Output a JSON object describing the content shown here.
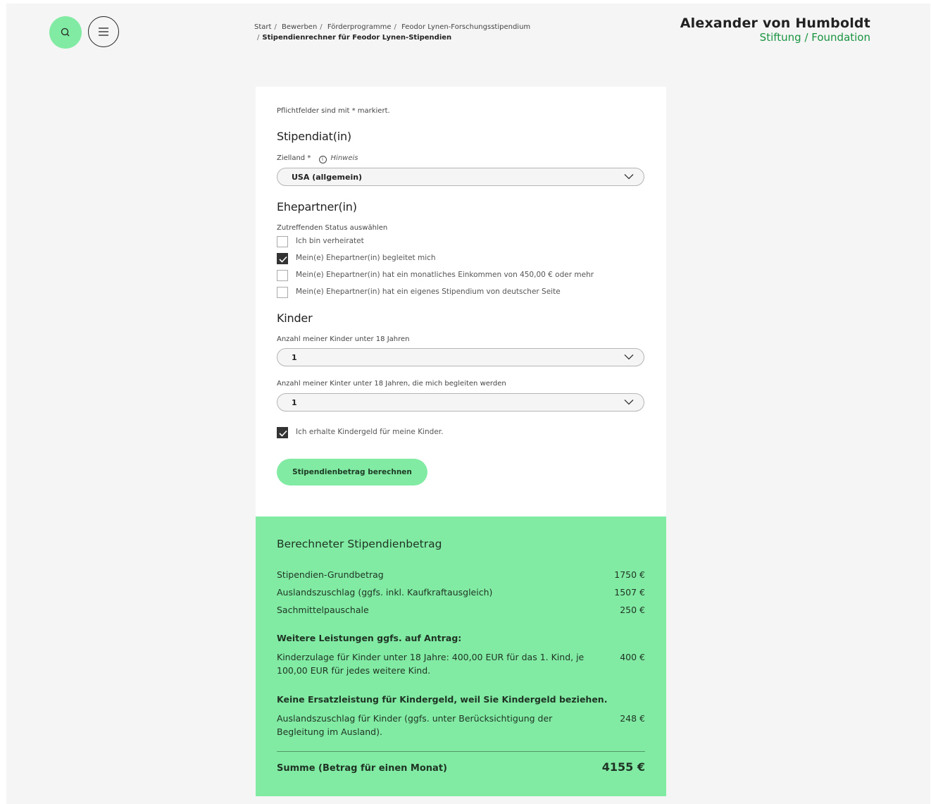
{
  "header": {
    "search_icon": "search-icon",
    "menu_icon": "hamburger-menu-icon",
    "breadcrumb": [
      "Start",
      "Bewerben",
      "Förderprogramme",
      "Feodor Lynen-Forschungsstipendium"
    ],
    "breadcrumb_current": "Stipendienrechner für Feodor Lynen-Stipendien",
    "logo_line1": "Alexander von Humboldt",
    "logo_line2": "Stiftung / Foundation"
  },
  "form": {
    "required_note": "Pflichtfelder sind mit * markiert.",
    "section_scholar": "Stipendiat(in)",
    "country_label": "Zielland",
    "required_mark": "*",
    "hint": "Hinweis",
    "country_value": "USA (allgemein)",
    "section_spouse": "Ehepartner(in)",
    "status_label": "Zutreffenden Status auswählen",
    "checkboxes": [
      {
        "label": "Ich bin verheiratet",
        "checked": false
      },
      {
        "label": "Mein(e) Ehepartner(in) begleitet mich",
        "checked": true
      },
      {
        "label": "Mein(e) Ehepartner(in) hat ein monatliches Einkommen von 450,00 € oder mehr",
        "checked": false
      },
      {
        "label": "Mein(e) Ehepartner(in) hat ein eigenes Stipendium von deutscher Seite",
        "checked": false
      }
    ],
    "section_children": "Kinder",
    "children_label": "Anzahl meiner Kinder unter 18 Jahren",
    "children_value": "1",
    "children_accompany_label": "Anzahl meiner Kinter unter 18 Jahren, die mich begleiten werden",
    "children_accompany_value": "1",
    "child_benefit_label": "Ich erhalte Kindergeld für meine Kinder.",
    "child_benefit_checked": true,
    "calc_button": "Stipendienbetrag berechnen"
  },
  "result": {
    "title": "Berechneter Stipendienbetrag",
    "rows": [
      {
        "label": "Stipendien-Grundbetrag",
        "amount": "1750 €"
      },
      {
        "label": "Auslandszuschlag (ggfs. inkl. Kaufkraftausgleich)",
        "amount": "1507 €"
      },
      {
        "label": "Sachmittelpauschale",
        "amount": "250 €"
      }
    ],
    "further_heading": "Weitere Leistungen ggfs. auf Antrag:",
    "child_allowance": {
      "label": "Kinderzulage für Kinder unter 18 Jahre: 400,00 EUR für das 1. Kind, je 100,00 EUR für jedes weitere Kind.",
      "amount": "400 €"
    },
    "no_substitute": "Keine Ersatzleistung für Kindergeld, weil Sie Kindergeld beziehen.",
    "child_foreign": {
      "label": "Auslandszuschlag für Kinder (ggfs. unter Berücksichtigung der Begleitung im Ausland).",
      "amount": "248 €"
    },
    "sum_label": "Summe (Betrag für einen Monat)",
    "sum_amount": "4155 €"
  },
  "colors": {
    "accent": "#82eba3",
    "logo_green": "#1a9441",
    "background": "#f5f5f5"
  }
}
